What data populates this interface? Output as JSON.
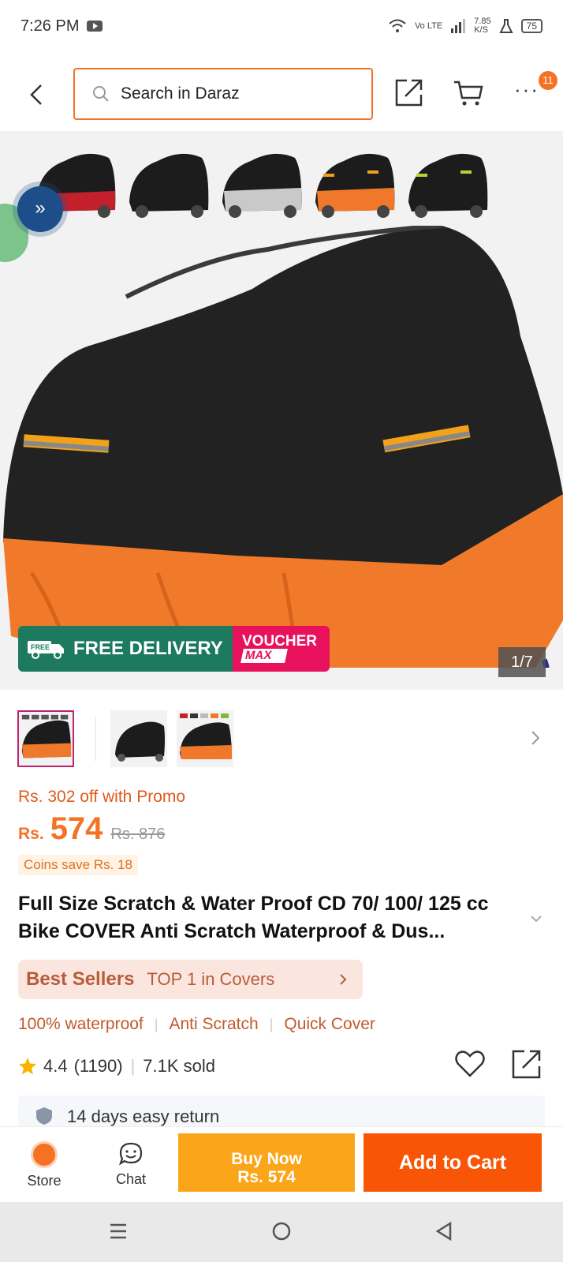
{
  "status_bar": {
    "time": "7:26 PM",
    "network_speed": "7.85\nK/S",
    "battery": "75",
    "volte": "Vo LTE"
  },
  "header": {
    "search_placeholder": "Search in Daraz",
    "cart_badge": "11"
  },
  "gallery": {
    "variant_colors": [
      "red",
      "black",
      "silver",
      "orange",
      "green"
    ],
    "counter": "1/7",
    "banner_free": "FREE",
    "banner_delivery": "FREE DELIVERY",
    "banner_voucher": "VOUCHER",
    "banner_max": "MAX"
  },
  "product": {
    "promo": "Rs. 302 off with Promo",
    "currency": "Rs.",
    "price": "574",
    "old_price": "Rs. 876",
    "coins": "Coins save Rs. 18",
    "title": "Full Size Scratch & Water Proof CD 70/ 100/ 125 cc Bike COVER Anti Scratch Waterproof & Dus...",
    "bestseller_label": "Best Sellers",
    "bestseller_rank": "TOP 1 in Covers",
    "tags": [
      "100% waterproof",
      "Anti Scratch",
      "Quick Cover"
    ],
    "rating": "4.4",
    "rating_count": "(1190)",
    "sold": "7.1K sold",
    "returns": "14 days easy return"
  },
  "bottom_bar": {
    "store_label": "Store",
    "chat_label": "Chat",
    "buy_now_label": "Buy Now",
    "buy_now_price": "Rs. 574",
    "add_to_cart_label": "Add to Cart"
  },
  "colors": {
    "accent": "#f57224",
    "buy_now": "#fba61a",
    "add_to_cart": "#f85606",
    "delivery_green": "#1d7a5f",
    "voucher_pink": "#e8125c"
  }
}
